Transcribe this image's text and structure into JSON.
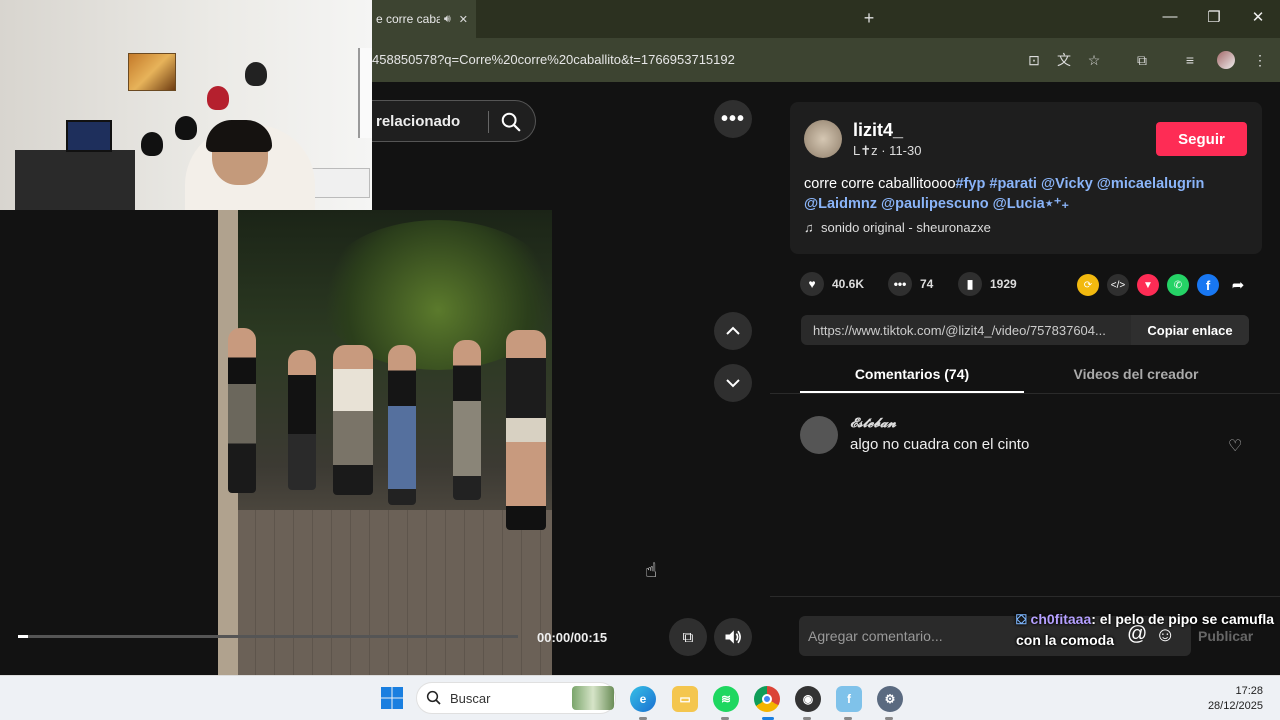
{
  "browser": {
    "tab_title": "e corre caba",
    "url": "458850578?q=Corre%20corre%20caballito&t=1766953715192"
  },
  "video": {
    "related_label": "relacionado",
    "timecode": "00:00/00:15",
    "progress": 0.02
  },
  "post": {
    "username": "lizit4_",
    "subline": "L✝z · 11-30",
    "follow_label": "Seguir",
    "caption_text": "corre corre caballitoooo",
    "caption_tags": [
      "#fyp",
      "#parati",
      "@Vicky",
      "@micaelalugrin",
      "@Laidmnz",
      "@paulipescuno",
      "@Lucia⋆⁺₊"
    ],
    "sound": "sonido original - sheuronazxe",
    "likes": "40.6K",
    "comments": "74",
    "saves": "1929",
    "link": "https://www.tiktok.com/@lizit4_/video/757837604...",
    "copy_label": "Copiar enlace",
    "tabs": [
      "Comentarios (74)",
      "Videos del creador"
    ]
  },
  "comment": {
    "user": "𝓔𝓼𝓽𝓮𝓫𝓪𝓷",
    "text": "algo no cuadra con el cinto"
  },
  "composer": {
    "placeholder": "Agregar comentario...",
    "publish_label": "Publicar"
  },
  "chat_overlay": {
    "user": "ch0fitaaa",
    "message": ": el pelo de pipo se camufla con la comoda"
  },
  "taskbar": {
    "search_label": "Buscar",
    "time": "17:28",
    "date": "28/12/2025"
  },
  "colors": {
    "accent": "#fe2c55",
    "tag": "#8ab4f8"
  }
}
